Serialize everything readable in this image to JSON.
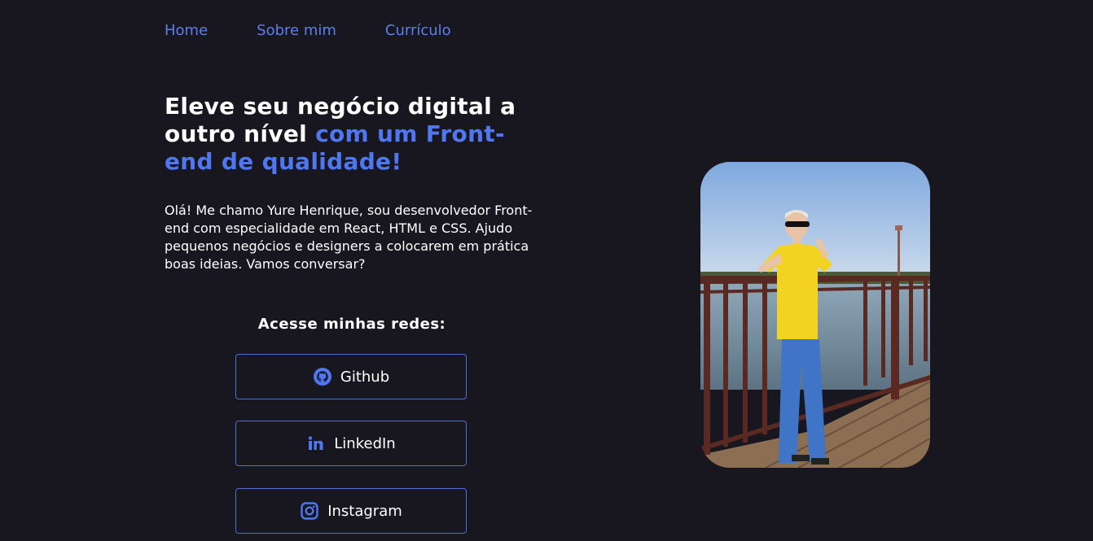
{
  "nav": {
    "items": [
      "Home",
      "Sobre mim",
      "Currículo"
    ]
  },
  "hero": {
    "headline_white": "Eleve seu negócio digital a outro nível ",
    "headline_accent": "com um Front-end de qualidade!",
    "intro": "Olá! Me chamo Yure Henrique, sou desenvolvedor Front-end com especialidade em React, HTML e CSS. Ajudo pequenos negócios e designers a colocarem em prática boas ideias. Vamos conversar?"
  },
  "socials": {
    "title": "Acesse minhas redes:",
    "buttons": [
      {
        "label": "Github",
        "icon": "github-icon"
      },
      {
        "label": "LinkedIn",
        "icon": "linkedin-icon"
      },
      {
        "label": "Instagram",
        "icon": "instagram-icon"
      }
    ]
  },
  "colors": {
    "background": "#18171f",
    "accent": "#4f77f2",
    "text": "#ffffff"
  }
}
